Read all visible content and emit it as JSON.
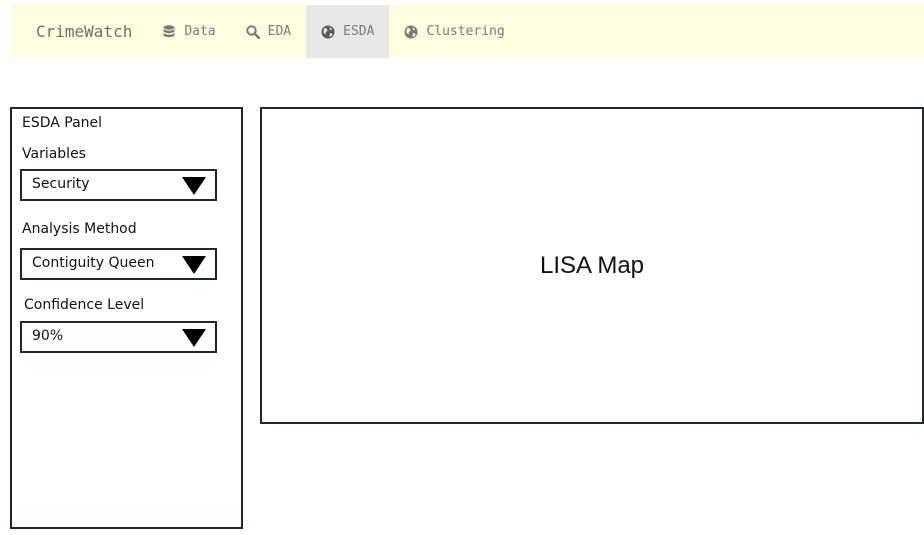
{
  "navbar": {
    "brand": "CrimeWatch",
    "tabs": [
      {
        "label": "Data",
        "icon": "database-icon",
        "active": false
      },
      {
        "label": "EDA",
        "icon": "search-icon",
        "active": false
      },
      {
        "label": "ESDA",
        "icon": "globe-icon",
        "active": true
      },
      {
        "label": "Clustering",
        "icon": "globe-icon",
        "active": false
      }
    ],
    "background_color": "#fdfde0",
    "active_tab_color": "#e7e7e7"
  },
  "panel": {
    "title": "ESDA Panel",
    "fields": [
      {
        "label": "Variables",
        "value": "Security"
      },
      {
        "label": "Analysis Method",
        "value": "Contiguity Queen"
      },
      {
        "label": "Confidence Level",
        "value": "90%"
      }
    ]
  },
  "map": {
    "title": "LISA Map"
  }
}
